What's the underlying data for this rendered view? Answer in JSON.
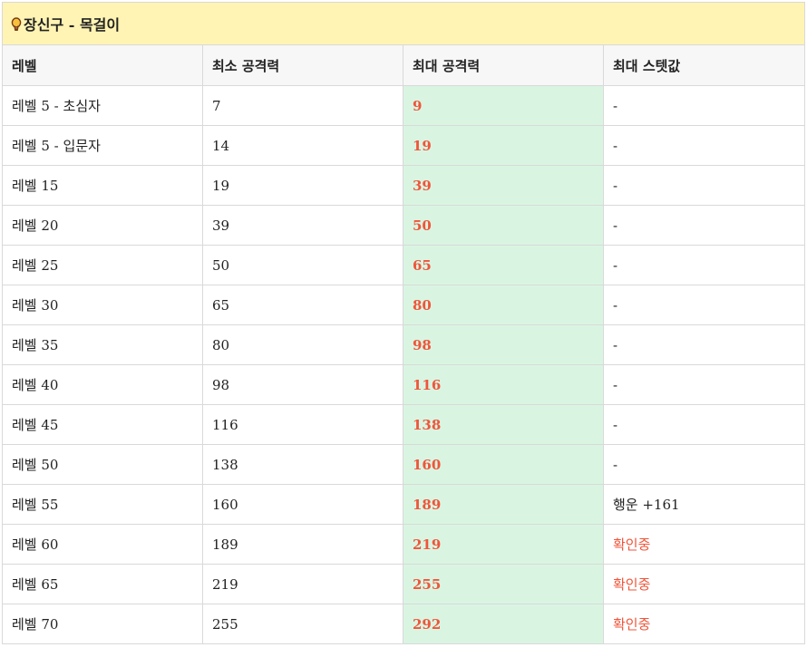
{
  "title": {
    "icon": "light-bulb-icon",
    "text": "장신구 - 목걸이"
  },
  "columns": [
    "레벨",
    "최소 공격력",
    "최대 공격력",
    "최대 스텟값"
  ],
  "colors": {
    "title_bg": "#fff4b3",
    "max_col_bg": "#d9f5e2",
    "accent_red": "#f0553a"
  },
  "rows": [
    {
      "level": "레벨 5 - 초심자",
      "min": "7",
      "max": "9",
      "stat": "-"
    },
    {
      "level": "레벨 5 - 입문자",
      "min": "14",
      "max": "19",
      "stat": "-"
    },
    {
      "level": "레벨 15",
      "min": "19",
      "max": "39",
      "stat": "-"
    },
    {
      "level": "레벨 20",
      "min": "39",
      "max": "50",
      "stat": "-"
    },
    {
      "level": "레벨 25",
      "min": "50",
      "max": "65",
      "stat": "-"
    },
    {
      "level": "레벨 30",
      "min": "65",
      "max": "80",
      "stat": "-"
    },
    {
      "level": "레벨 35",
      "min": "80",
      "max": "98",
      "stat": "-"
    },
    {
      "level": "레벨 40",
      "min": "98",
      "max": "116",
      "stat": "-"
    },
    {
      "level": "레벨 45",
      "min": "116",
      "max": "138",
      "stat": "-"
    },
    {
      "level": "레벨 50",
      "min": "138",
      "max": "160",
      "stat": "-"
    },
    {
      "level": "레벨 55",
      "min": "160",
      "max": "189",
      "stat": "행운 +161"
    },
    {
      "level": "레벨 60",
      "min": "189",
      "max": "219",
      "stat": "확인중",
      "stat_highlight": true
    },
    {
      "level": "레벨 65",
      "min": "219",
      "max": "255",
      "stat": "확인중",
      "stat_highlight": true
    },
    {
      "level": "레벨 70",
      "min": "255",
      "max": "292",
      "stat": "확인중",
      "stat_highlight": true
    }
  ]
}
